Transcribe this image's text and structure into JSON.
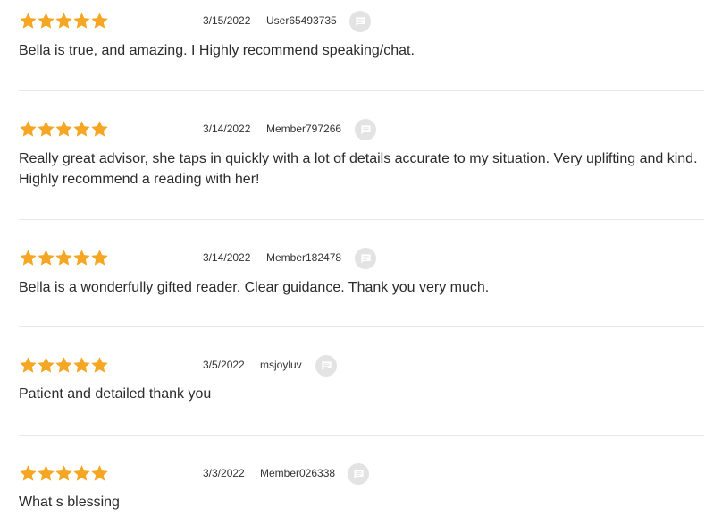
{
  "colors": {
    "star": "#F5A623",
    "comment_button_bg": "#E3E3E3",
    "comment_icon": "#FFFFFF",
    "divider": "#E8E8E8",
    "text": "#2B2B2B"
  },
  "reviews": [
    {
      "rating": 5,
      "date": "3/15/2022",
      "user": "User65493735",
      "text": "Bella is true, and amazing. I Highly recommend speaking/chat.",
      "comment_icon": "comment-bubble-icon"
    },
    {
      "rating": 5,
      "date": "3/14/2022",
      "user": "Member797266",
      "text": "Really great advisor, she taps in quickly with a lot of details accurate to my situation. Very uplifting and kind. Highly recommend a reading with her!",
      "comment_icon": "comment-bubble-icon"
    },
    {
      "rating": 5,
      "date": "3/14/2022",
      "user": "Member182478",
      "text": "Bella is a wonderfully gifted reader. Clear guidance. Thank you very much.",
      "comment_icon": "comment-bubble-icon"
    },
    {
      "rating": 5,
      "date": "3/5/2022",
      "user": "msjoyluv",
      "text": "Patient and detailed thank you",
      "comment_icon": "comment-bubble-icon"
    },
    {
      "rating": 5,
      "date": "3/3/2022",
      "user": "Member026338",
      "text": "What s blessing",
      "comment_icon": "comment-bubble-icon"
    }
  ]
}
